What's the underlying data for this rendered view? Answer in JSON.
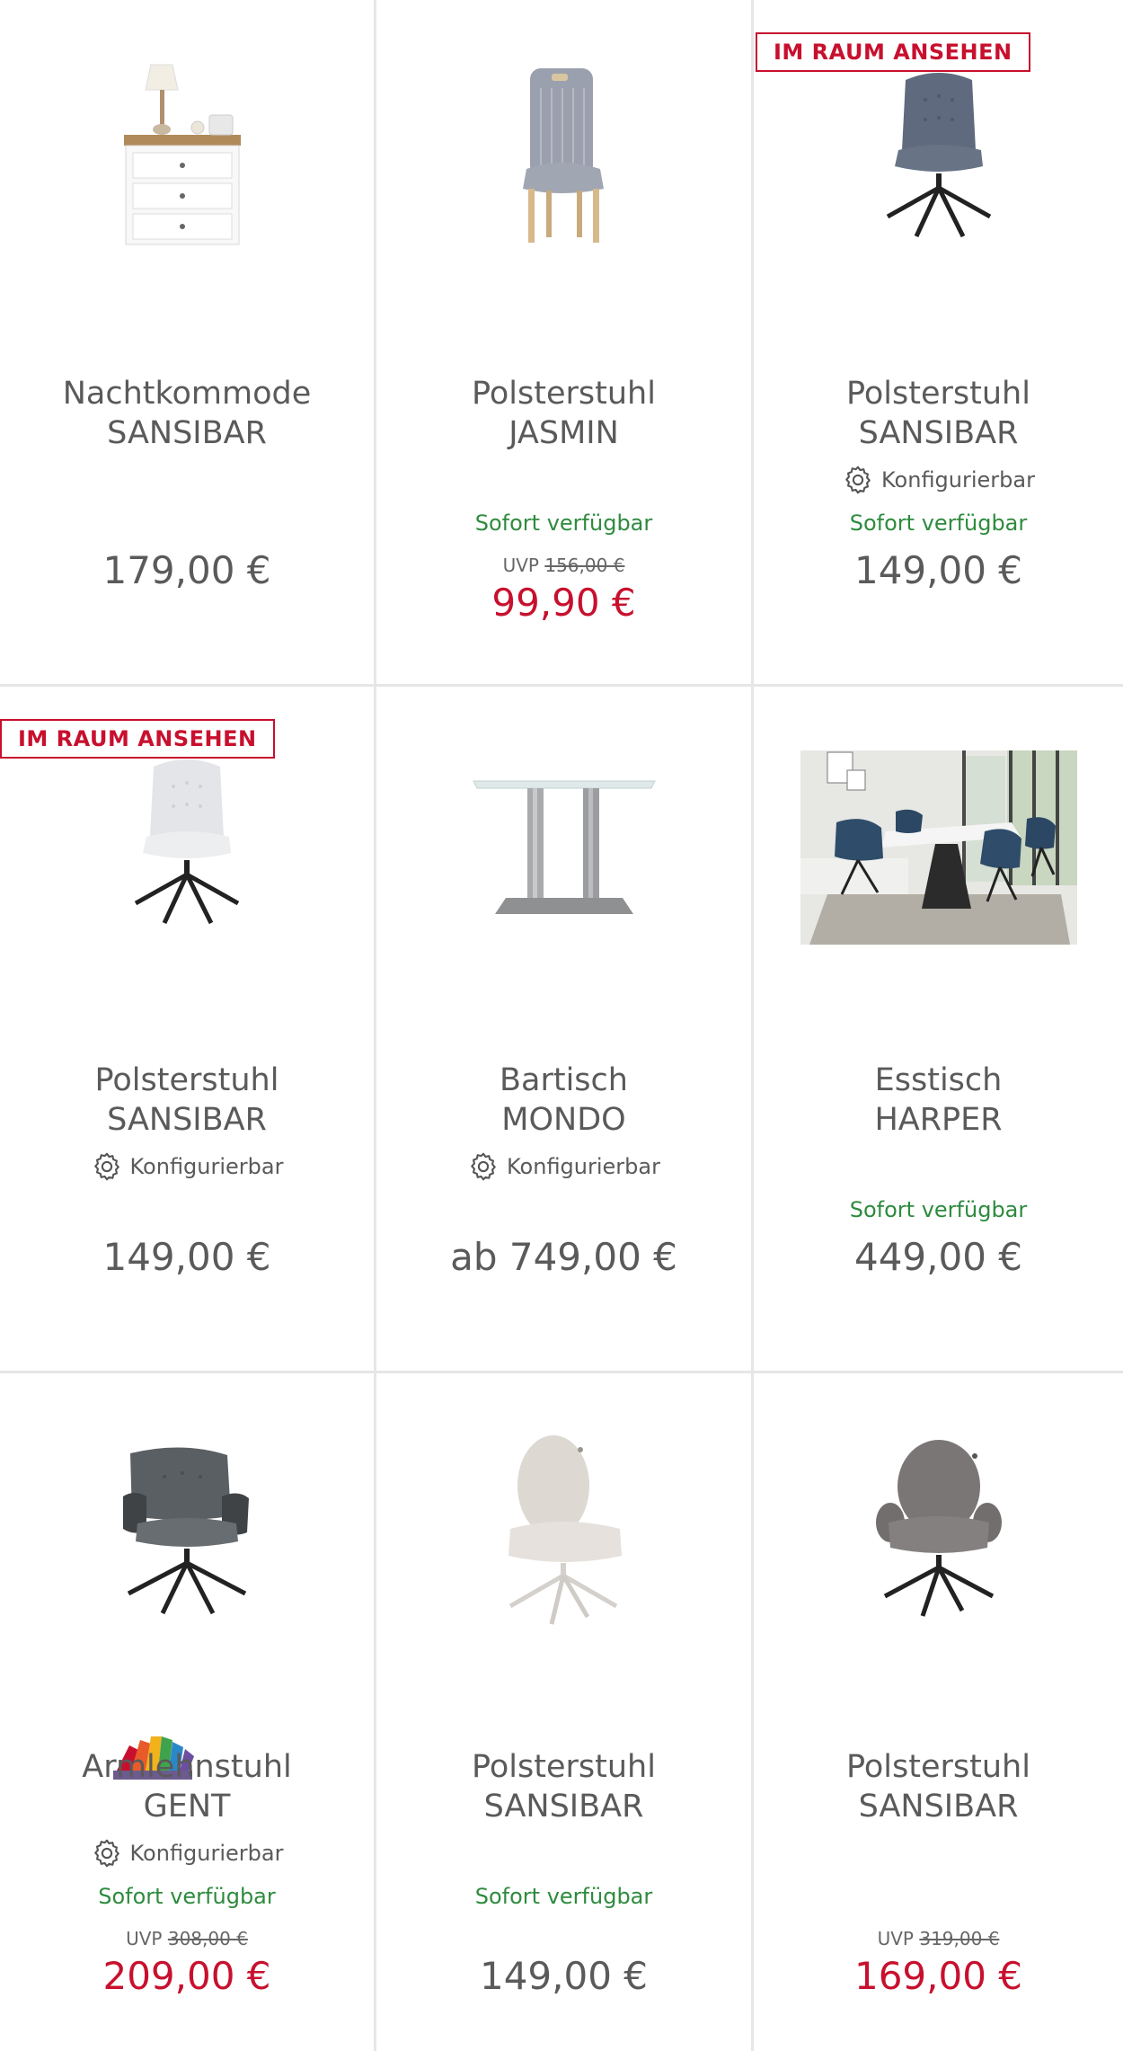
{
  "colors": {
    "accent_red": "#c8102e",
    "available_green": "#2e8b3e",
    "text_gray": "#5a5a5a",
    "divider": "#e6e6e6"
  },
  "products": [
    {
      "badge": "",
      "image_icon": "nightstand-image",
      "name_line1": "Nachtkommode",
      "name_line2": "SANSIBAR",
      "configurable": "",
      "availability": "",
      "uvp_label": "",
      "uvp_old": "",
      "price": "179,00 €",
      "sale": false
    },
    {
      "badge": "",
      "image_icon": "chair-image",
      "name_line1": "Polsterstuhl",
      "name_line2": "JASMIN",
      "configurable": "",
      "availability": "Sofort verfügbar",
      "uvp_label": "UVP",
      "uvp_old": "156,00 €",
      "price": "99,90 €",
      "sale": true
    },
    {
      "badge": "IM RAUM ANSEHEN",
      "image_icon": "swivel-chair-image",
      "name_line1": "Polsterstuhl",
      "name_line2": "SANSIBAR",
      "configurable": "Konfigurierbar",
      "availability": "Sofort verfügbar",
      "uvp_label": "",
      "uvp_old": "",
      "price": "149,00 €",
      "sale": false
    },
    {
      "badge": "IM RAUM ANSEHEN",
      "image_icon": "swivel-chair-image",
      "name_line1": "Polsterstuhl",
      "name_line2": "SANSIBAR",
      "configurable": "Konfigurierbar",
      "availability": "",
      "uvp_label": "",
      "uvp_old": "",
      "price": "149,00 €",
      "sale": false
    },
    {
      "badge": "",
      "image_icon": "bar-table-image",
      "name_line1": "Bartisch",
      "name_line2": "MONDO",
      "configurable": "Konfigurierbar",
      "availability": "",
      "uvp_label": "",
      "uvp_old": "",
      "price": "ab 749,00 €",
      "sale": false
    },
    {
      "badge": "",
      "image_icon": "dining-room-image",
      "name_line1": "Esstisch",
      "name_line2": "HARPER",
      "configurable": "",
      "availability": "Sofort verfügbar",
      "uvp_label": "",
      "uvp_old": "",
      "price": "449,00 €",
      "sale": false
    },
    {
      "badge": "",
      "image_icon": "armchair-image",
      "name_line1": "Armlehnstuhl",
      "name_line2": "GENT",
      "configurable": "Konfigurierbar",
      "availability": "Sofort verfügbar",
      "uvp_label": "UVP",
      "uvp_old": "308,00 €",
      "price": "209,00 €",
      "sale": true
    },
    {
      "badge": "",
      "image_icon": "round-chair-image",
      "name_line1": "Polsterstuhl",
      "name_line2": "SANSIBAR",
      "configurable": "",
      "availability": "Sofort verfügbar",
      "uvp_label": "",
      "uvp_old": "",
      "price": "149,00 €",
      "sale": false
    },
    {
      "badge": "",
      "image_icon": "round-armchair-image",
      "name_line1": "Polsterstuhl",
      "name_line2": "SANSIBAR",
      "configurable": "",
      "availability": "",
      "uvp_label": "UVP",
      "uvp_old": "319,00 €",
      "price": "169,00 €",
      "sale": true
    }
  ]
}
